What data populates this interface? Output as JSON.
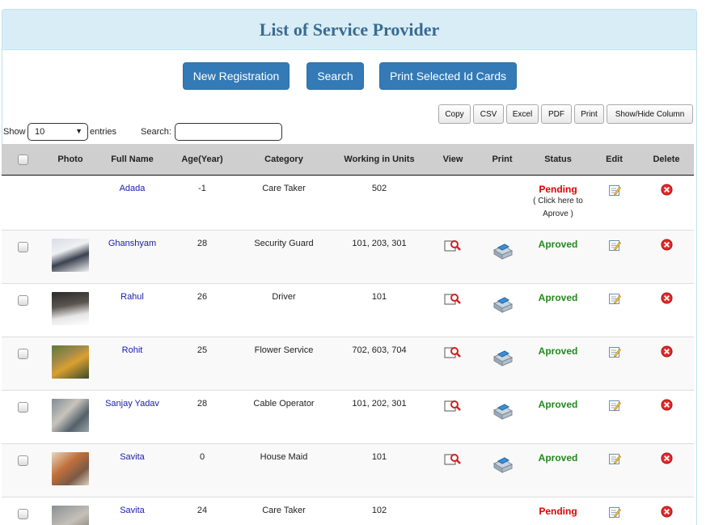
{
  "page": {
    "title": "List of Service Provider"
  },
  "actions": {
    "new_registration": "New Registration",
    "search": "Search",
    "print_selected": "Print Selected Id Cards"
  },
  "export": {
    "copy": "Copy",
    "csv": "CSV",
    "excel": "Excel",
    "pdf": "PDF",
    "print": "Print",
    "show_hide": "Show/Hide Column"
  },
  "table_controls": {
    "show_label": "Show",
    "page_size": "10",
    "entries_label": "entries",
    "search_label": "Search:"
  },
  "columns": [
    "Photo",
    "Full Name",
    "Age(Year)",
    "Category",
    "Working in Units",
    "View",
    "Print",
    "Status",
    "Edit",
    "Delete"
  ],
  "rows": [
    {
      "name": "Adada",
      "age": "-1",
      "category": "Care Taker",
      "units": "502",
      "status": "Pending",
      "status_note_1": "( Click here to",
      "status_note_2": "Aprove )"
    },
    {
      "name": "Ghanshyam",
      "age": "28",
      "category": "Security Guard",
      "units": "101, 203, 301",
      "status": "Aproved"
    },
    {
      "name": "Rahul",
      "age": "26",
      "category": "Driver",
      "units": "101",
      "status": "Aproved"
    },
    {
      "name": "Rohit",
      "age": "25",
      "category": "Flower Service",
      "units": "702, 603, 704",
      "status": "Aproved"
    },
    {
      "name": "Sanjay Yadav",
      "age": "28",
      "category": "Cable Operator",
      "units": "101, 202, 301",
      "status": "Aproved"
    },
    {
      "name": "Savita",
      "age": "0",
      "category": "House Maid",
      "units": "101",
      "status": "Aproved"
    },
    {
      "name": "Savita",
      "age": "24",
      "category": "Care Taker",
      "units": "102",
      "status": "Pending"
    }
  ],
  "colors": {
    "primary": "#337ab7",
    "header_bg": "#d9edf7",
    "title": "#3a6b91",
    "pending": "#e00000",
    "approved": "#23881f",
    "link": "#1a1ab0"
  }
}
